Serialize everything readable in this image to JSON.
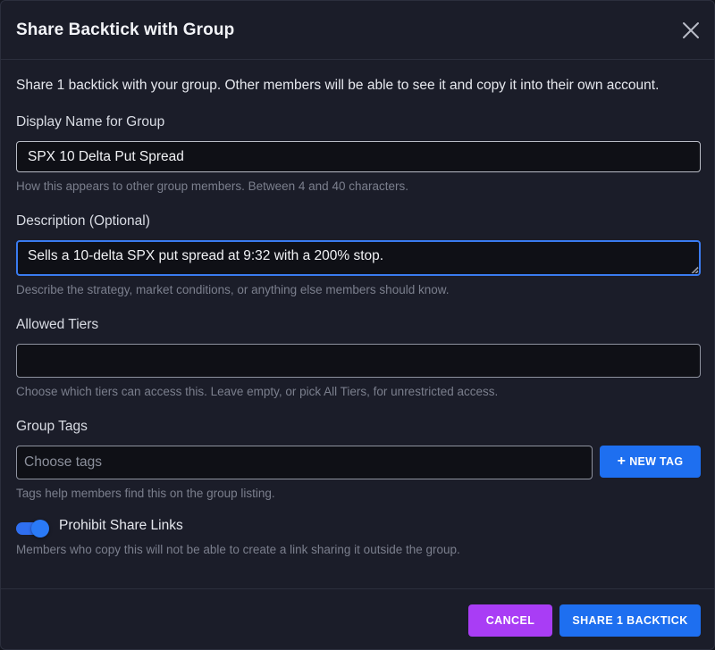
{
  "dialog": {
    "title": "Share Backtick with Group",
    "intro": "Share 1 backtick with your group. Other members will be able to see it and copy it into their own account."
  },
  "display_name": {
    "label": "Display Name for Group",
    "value": "SPX 10 Delta Put Spread",
    "hint": "How this appears to other group members. Between 4 and 40 characters."
  },
  "description": {
    "label": "Description (Optional)",
    "value": "Sells a 10-delta SPX put spread at 9:32 with a 200% stop.",
    "hint": "Describe the strategy, market conditions, or anything else members should know."
  },
  "allowed_tiers": {
    "label": "Allowed Tiers",
    "value": "",
    "hint": "Choose which tiers can access this. Leave empty, or pick All Tiers, for unrestricted access."
  },
  "group_tags": {
    "label": "Group Tags",
    "placeholder": "Choose tags",
    "new_tag_label": "NEW TAG",
    "hint": "Tags help members find this on the group listing."
  },
  "prohibit_share_links": {
    "label": "Prohibit Share Links",
    "enabled": true,
    "hint": "Members who copy this will not be able to create a link sharing it outside the group."
  },
  "footer": {
    "cancel_label": "CANCEL",
    "share_label": "SHARE 1 BACKTICK"
  },
  "colors": {
    "primary": "#1e6ff0",
    "cancel": "#a93df5",
    "focus_border": "#3a7bf0"
  },
  "icons": {
    "close": "close-icon",
    "plus": "plus-icon"
  }
}
